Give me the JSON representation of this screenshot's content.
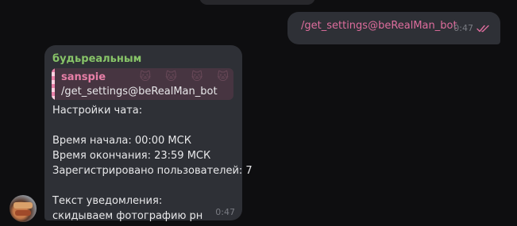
{
  "outgoing": {
    "text": "/get_settings@beRealMan_bot",
    "time": "0:47",
    "status_icon": "double-check-icon",
    "text_color": "#de6d9d"
  },
  "incoming": {
    "sender": "будьреальным",
    "sender_color": "#87c468",
    "reply": {
      "author": "sanspie",
      "text": "/get_settings@beRealMan_bot",
      "accent_color": "#e77fa7",
      "pattern_icon": "cat-face-icon"
    },
    "lines": [
      "Настройки чата:",
      "",
      "Время начала: 00:00 МСК",
      "Время окончания: 23:59 МСК",
      "Зарегистрировано пользователей: 7",
      "",
      "Текст уведомления:",
      "скидываем фотографию рн"
    ],
    "time": "0:47"
  }
}
